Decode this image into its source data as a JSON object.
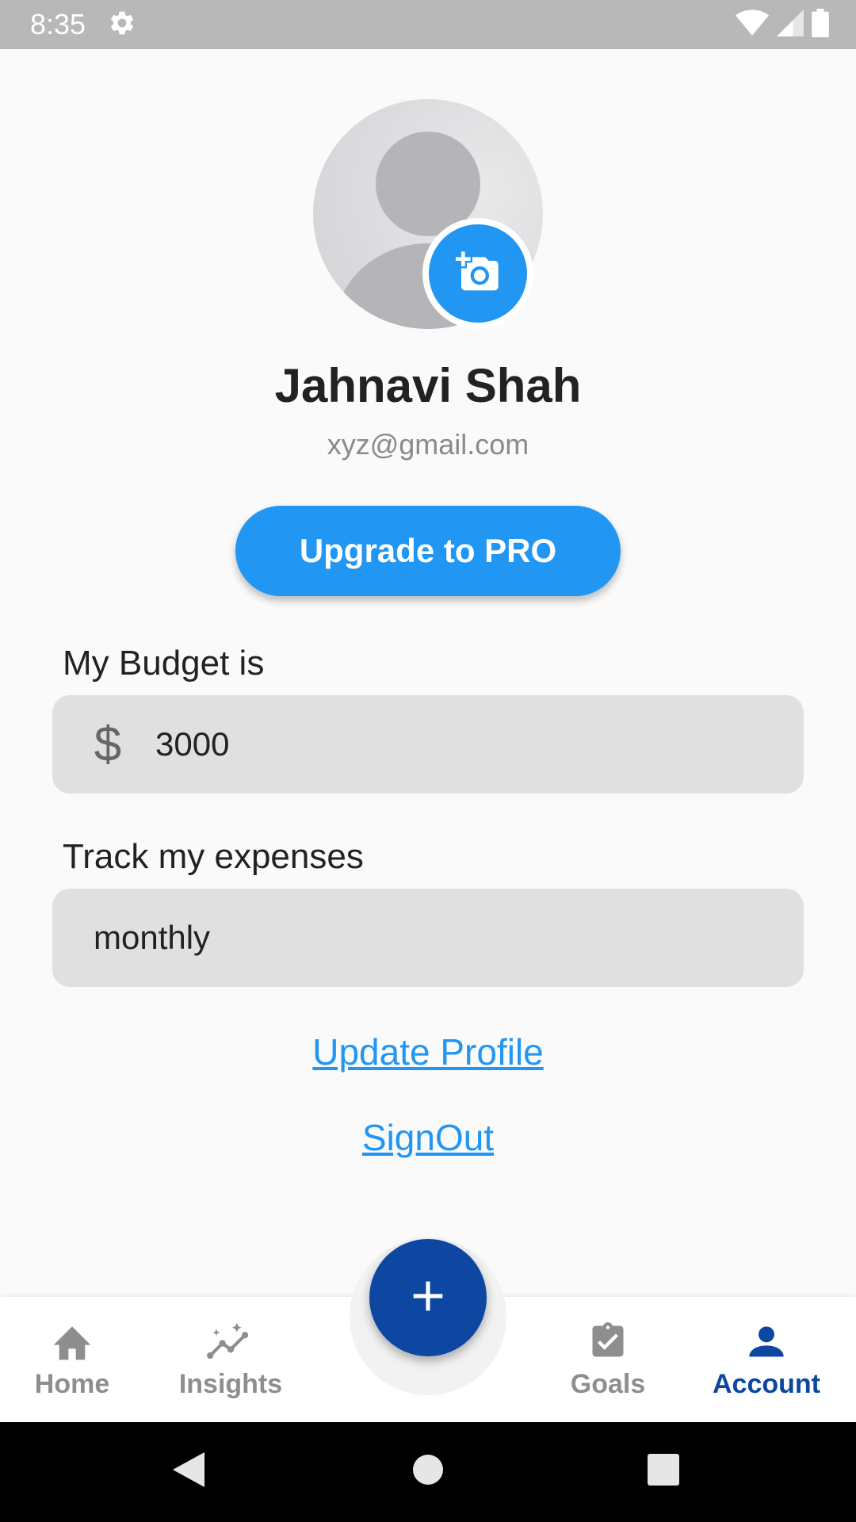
{
  "status_bar": {
    "time": "8:35",
    "icons": [
      "gear-icon",
      "wifi-icon",
      "signal-icon",
      "battery-icon"
    ]
  },
  "profile": {
    "name": "Jahnavi Shah",
    "email": "xyz@gmail.com",
    "avatar_icon": "person-placeholder-icon",
    "camera_icon": "add-a-photo-icon"
  },
  "upgrade_button": {
    "label": "Upgrade to PRO"
  },
  "budget": {
    "label": "My Budget is",
    "currency_symbol": "$",
    "value": "3000"
  },
  "tracking": {
    "label": "Track my expenses",
    "value": "monthly"
  },
  "links": {
    "update_profile": "Update Profile",
    "sign_out": "SignOut"
  },
  "bottom_nav": {
    "items": [
      {
        "label": "Home",
        "icon": "home-icon",
        "active": false
      },
      {
        "label": "Insights",
        "icon": "insights-icon",
        "active": false
      },
      {
        "label": "Goals",
        "icon": "assignment-turned-in-icon",
        "active": false
      },
      {
        "label": "Account",
        "icon": "person-icon",
        "active": true
      }
    ],
    "fab_icon": "plus-icon"
  },
  "colors": {
    "primary": "#2196f3",
    "dark_primary": "#0d47a1",
    "inactive": "#8e8e8e",
    "field_bg": "#e0e0e0"
  }
}
